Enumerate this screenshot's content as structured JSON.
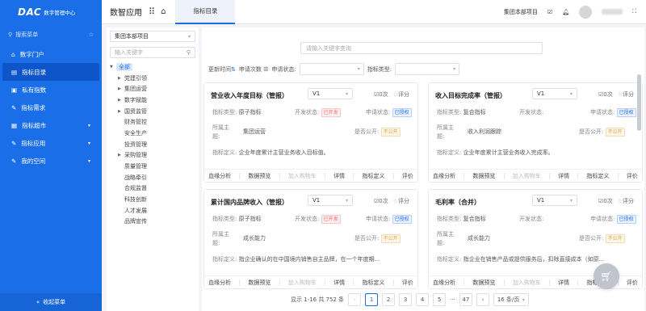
{
  "sidebar": {
    "logo_mark": "DAC",
    "logo_text": "数字管理中心",
    "search_label": "搜索菜单",
    "pin_icon": "☆",
    "items": [
      {
        "label": "数字门户",
        "icon": "⌂"
      },
      {
        "label": "指标目录",
        "icon": "▤",
        "active": true
      },
      {
        "label": "私有指数",
        "icon": "▣"
      },
      {
        "label": "指标需求",
        "icon": "✎"
      },
      {
        "label": "指标超市",
        "icon": "▦",
        "chev": "▾"
      },
      {
        "label": "指标应用",
        "icon": "✎",
        "chev": "▾"
      },
      {
        "label": "我的空间",
        "icon": "✎",
        "chev": "▾"
      }
    ],
    "collapse_label": "收起菜单",
    "collapse_icon": "«"
  },
  "topbar": {
    "app_title": "数智应用",
    "tab_label": "指标目录",
    "project": "集团本部项目",
    "icons": {
      "grid": "⠿",
      "home": "⌂",
      "check": "☑",
      "bell": "🔔︎",
      "expand": "⛶"
    }
  },
  "tree": {
    "select_value": "集团本部项目",
    "input_placeholder": "输入关键字",
    "root": "全部",
    "nodes": [
      {
        "label": "党建引领",
        "expandable": true
      },
      {
        "label": "集团运营",
        "expandable": true
      },
      {
        "label": "数字赋能",
        "expandable": true
      },
      {
        "label": "国资监管",
        "expandable": true
      },
      {
        "label": "财务管控",
        "expandable": false
      },
      {
        "label": "安全生产",
        "expandable": false
      },
      {
        "label": "投资管理",
        "expandable": false
      },
      {
        "label": "采购管理",
        "expandable": true
      },
      {
        "label": "质量管理",
        "expandable": false
      },
      {
        "label": "战略牵引",
        "expandable": false
      },
      {
        "label": "合规监督",
        "expandable": false
      },
      {
        "label": "科技创新",
        "expandable": false
      },
      {
        "label": "人才发展",
        "expandable": false
      },
      {
        "label": "品牌宣传",
        "expandable": false
      }
    ]
  },
  "main": {
    "search_placeholder": "请输入关键字查询",
    "filters": {
      "update_time": "更新时间",
      "apply_count": "申请次数",
      "apply_status": "申请状态:",
      "indicator_type": "指标类型:"
    },
    "labels": {
      "type": "指标类型:",
      "dev_status": "开发状态:",
      "apply_status": "申请状态:",
      "subject": "所属主题:",
      "public": "是否公开:",
      "definition": "指标定义:",
      "rate": "评分"
    },
    "cards": [
      {
        "title": "营业收入年度目标（管报）",
        "version": "V1",
        "views": "0次",
        "type": "原子指标",
        "dev_status": "已开发",
        "apply_status": "已授权",
        "subject": "集团运营",
        "public": "不公开",
        "definition": "企业年度累计主营业务收入目标值。"
      },
      {
        "title": "收入目标完成率（管报）",
        "version": "V1",
        "views": "0次",
        "type": "复合指标",
        "dev_status": "",
        "apply_status": "已授权",
        "subject": "收入利润跟踪",
        "public": "不公开",
        "definition": "企业年度累计主营业务收入完成率。"
      },
      {
        "title": "累计国内品牌收入（管报）",
        "version": "V1",
        "views": "0次",
        "type": "原子指标",
        "dev_status": "已开发",
        "apply_status": "已授权",
        "subject": "成长能力",
        "public": "不公开",
        "definition": "指企业确认的在中国境内销售自主品牌，在一个年度期..."
      },
      {
        "title": "毛利率（合并）",
        "version": "V1",
        "views": "0次",
        "type": "复合指标",
        "dev_status": "",
        "apply_status": "已授权",
        "subject": "成长能力",
        "public": "不公开",
        "definition": "指企业在销售产品或提供服务后，扣除直接成本（如原..."
      }
    ],
    "actions": [
      "血缘分析",
      "数据预览",
      "加入购物车",
      "详情",
      "指标定义",
      "评价"
    ],
    "pagination": {
      "summary": "显示 1-16 共 752 条",
      "prev": "‹",
      "pages": [
        "1",
        "2",
        "3",
        "4",
        "5"
      ],
      "ellipsis": "···",
      "last": "47",
      "next": "›",
      "page_size": "16 条/页",
      "current": "1"
    }
  }
}
